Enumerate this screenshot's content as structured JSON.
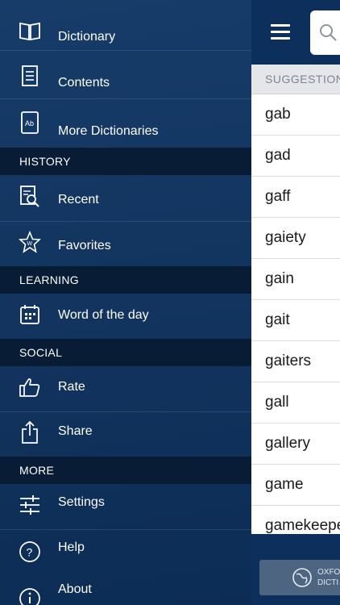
{
  "drawer": {
    "items": [
      {
        "label": "Dictionary",
        "icon": "book-icon"
      },
      {
        "label": "Contents",
        "icon": "document-icon"
      },
      {
        "label": "More Dictionaries",
        "icon": "dictionary-ab-icon"
      }
    ],
    "history": {
      "title": "HISTORY",
      "items": [
        {
          "label": "Recent",
          "icon": "recent-search-icon"
        },
        {
          "label": "Favorites",
          "icon": "star-w-icon"
        }
      ]
    },
    "learning": {
      "title": "LEARNING",
      "items": [
        {
          "label": "Word of the day",
          "icon": "calendar-icon"
        }
      ]
    },
    "social": {
      "title": "SOCIAL",
      "items": [
        {
          "label": "Rate",
          "icon": "thumbs-up-icon"
        },
        {
          "label": "Share",
          "icon": "share-icon"
        }
      ]
    },
    "more": {
      "title": "MORE",
      "items": [
        {
          "label": "Settings",
          "icon": "sliders-icon"
        },
        {
          "label": "Help",
          "icon": "help-icon"
        },
        {
          "label": "About",
          "icon": "info-icon"
        }
      ]
    }
  },
  "main": {
    "suggestions_header": "SUGGESTIONS",
    "words": [
      "gab",
      "gad",
      "gaff",
      "gaiety",
      "gain",
      "gait",
      "gaiters",
      "gall",
      "gallery",
      "game",
      "gamekeeper"
    ],
    "brand_text_line1": "OXFO",
    "brand_text_line2": "DICTI"
  },
  "colors": {
    "drawer_bg": "#0e3463",
    "section_bg": "#081c36",
    "topbar_bg": "#0d2f5c",
    "suggest_header_bg": "#e4e6ea"
  }
}
